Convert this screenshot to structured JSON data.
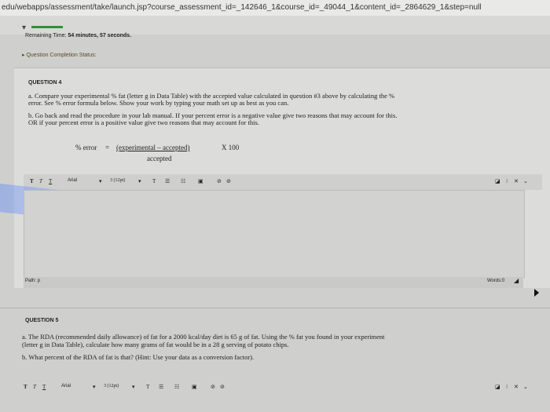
{
  "url": "edu/webapps/assessment/take/launch.jsp?course_assessment_id=_142646_1&course_id=_49044_1&content_id=_2864629_1&step=null",
  "timer": {
    "label": "Remaining Time:",
    "value": "54 minutes, 57 seconds."
  },
  "completion_status": "Question Completion Status:",
  "q4": {
    "heading": "QUESTION 4",
    "line_a1": "a. Compare your experimental % fat (letter g in Data Table) with the accepted value calculated in question #3 above by calculating the %",
    "line_a2": "error. See % error formula below. Show your work by typing your math set up as best as you can.",
    "line_b1": "b. Go back and read the procedure in your lab manual. If your percent error is a negative value give two reasons that may account for this.",
    "line_b2": "OR if your percent error is a positive value give two reasons that may account for this.",
    "formula_left": "% error",
    "formula_eq": "=",
    "formula_num": "(experimental – accepted)",
    "formula_den": "accepted",
    "formula_mult": "X 100"
  },
  "toolbar": {
    "t1": "T",
    "t2": "T",
    "t3": "T",
    "font": "Arial",
    "size": "3 (12pt)",
    "t_color": "T",
    "path_label": "Path: p",
    "words_label": "Words:0"
  },
  "q5": {
    "heading": "QUESTION 5",
    "line_a1": "a. The RDA (recommended daily allowance) of fat for a 2000 kcal/day diet is 65 g of fat. Using the % fat you found in your experiment",
    "line_a2": "(letter g in Data Table), calculate how many grams of fat would be in a 28 g serving of potato chips.",
    "line_b1": "b. What percent of the RDA of fat is that? (Hint: Use your data as a conversion factor)."
  },
  "colors": {
    "accent_green": "#2f8f3a",
    "status_text": "#5a4a1e"
  }
}
